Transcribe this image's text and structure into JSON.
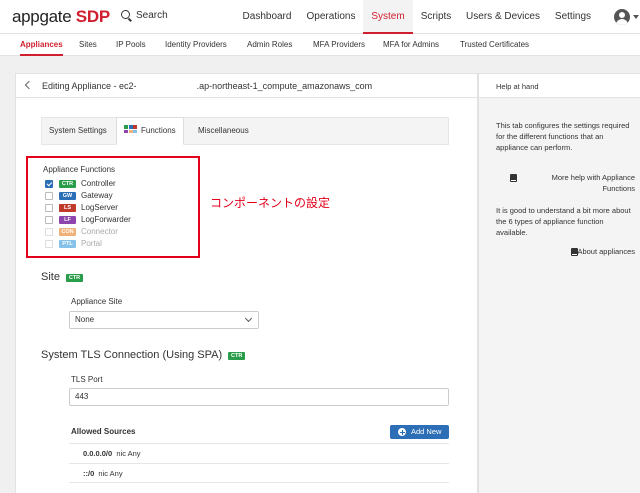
{
  "brand": {
    "name": "appgate",
    "suffix": "SDP",
    "color": "#d01f2e"
  },
  "search": {
    "label": "Search",
    "icon": "search-icon"
  },
  "nav": {
    "items": [
      {
        "label": "Dashboard"
      },
      {
        "label": "Operations"
      },
      {
        "label": "System",
        "active": true
      },
      {
        "label": "Scripts"
      },
      {
        "label": "Users & Devices"
      },
      {
        "label": "Settings"
      }
    ]
  },
  "subnav": {
    "items": [
      {
        "label": "Appliances",
        "active": true
      },
      {
        "label": "Sites"
      },
      {
        "label": "IP Pools"
      },
      {
        "label": "Identity Providers"
      },
      {
        "label": "Admin Roles"
      },
      {
        "label": "MFA Providers"
      },
      {
        "label": "MFA for Admins"
      },
      {
        "label": "Trusted Certificates"
      }
    ]
  },
  "editor": {
    "title_prefix": "Editing Appliance - ec2-",
    "title_suffix": ".ap-northeast-1_compute_amazonaws_com",
    "tabs": [
      {
        "label": "System Settings"
      },
      {
        "label": "Functions",
        "active": true
      },
      {
        "label": "Miscellaneous"
      }
    ],
    "functions": {
      "title": "Appliance Functions",
      "items": [
        {
          "badge": "CTR",
          "label": "Controller",
          "checked": true,
          "enabled": true,
          "color": "#2a9d4a"
        },
        {
          "badge": "GW",
          "label": "Gateway",
          "checked": false,
          "enabled": true,
          "color": "#2c6fb6"
        },
        {
          "badge": "LS",
          "label": "LogServer",
          "checked": false,
          "enabled": true,
          "color": "#c0392b"
        },
        {
          "badge": "LF",
          "label": "LogForwarder",
          "checked": false,
          "enabled": true,
          "color": "#8e44ad"
        },
        {
          "badge": "CON",
          "label": "Connector",
          "checked": false,
          "enabled": false,
          "color": "#f0b27a"
        },
        {
          "badge": "PTL",
          "label": "Portal",
          "checked": false,
          "enabled": false,
          "color": "#85c1e9"
        }
      ]
    },
    "annotation": "コンポーネントの設定",
    "site": {
      "heading": "Site",
      "badge": "CTR",
      "field_label": "Appliance Site",
      "value": "None"
    },
    "tls": {
      "heading": "System TLS Connection (Using SPA)",
      "badge": "CTR",
      "port_label": "TLS Port",
      "port_value": "443",
      "sources_label": "Allowed Sources",
      "add_button": "Add New",
      "sources": [
        {
          "address": "0.0.0.0/0",
          "detail": "nic  Any"
        },
        {
          "address": "::/0",
          "detail": "nic  Any"
        }
      ]
    }
  },
  "help": {
    "title": "Help at hand",
    "paragraph1": "This tab configures the settings required for the different functions that an appliance can perform.",
    "link1": "More help with Appliance Functions",
    "paragraph2": "It is good to understand a bit more about the 6 types of appliance function available.",
    "link2": "About appliances"
  }
}
